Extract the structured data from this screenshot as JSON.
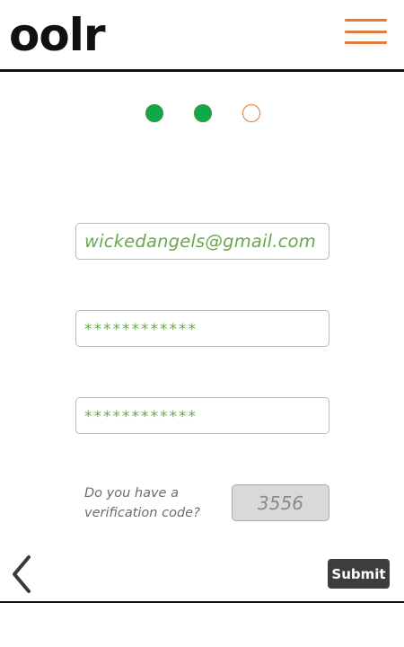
{
  "header": {
    "logo": "oolr",
    "menu_icon": "hamburger-menu-icon",
    "menu_color": "#e07b39"
  },
  "stepper": {
    "steps": [
      {
        "state": "complete"
      },
      {
        "state": "complete"
      },
      {
        "state": "incomplete"
      }
    ],
    "complete_color": "#0fa94a",
    "incomplete_color": "#e07b39"
  },
  "form": {
    "email_value": "wickedangels@gmail.com",
    "password_value": "************",
    "confirm_password_value": "************",
    "verification_prompt": "Do you have a verification code?",
    "verification_code": "3556",
    "text_color": "#6aa84f"
  },
  "footer": {
    "back_icon": "chevron-left-icon",
    "submit_label": "Submit"
  }
}
